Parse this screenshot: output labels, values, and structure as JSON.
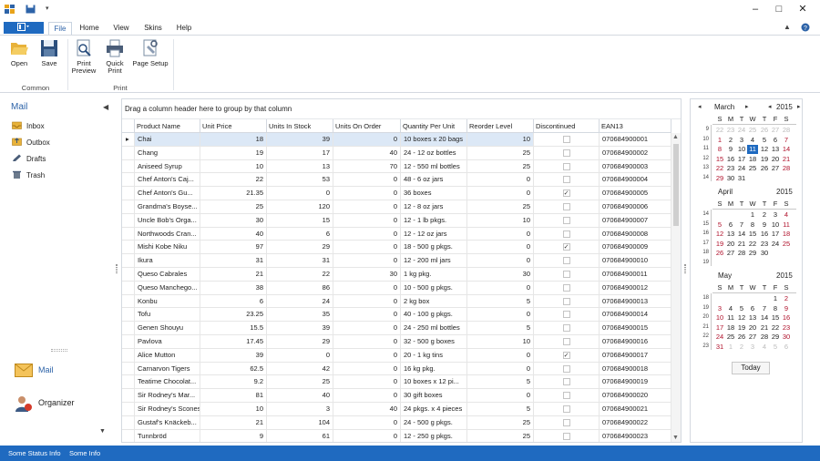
{
  "app": {
    "colors": {
      "accent": "#1f6ac0",
      "weekend": "#b0112b",
      "status_bar": "#1f6ac0"
    }
  },
  "window_controls": {
    "minimize": "‒",
    "maximize": "□",
    "close": "✕"
  },
  "ribbon": {
    "tabs": [
      "File",
      "Home",
      "View",
      "Skins",
      "Help"
    ],
    "active_tab": "File",
    "groups": [
      {
        "label": "Common",
        "buttons": [
          {
            "label": "Open",
            "icon": "folder-open-icon"
          },
          {
            "label": "Save",
            "icon": "floppy-disk-icon"
          }
        ]
      },
      {
        "label": "Print",
        "buttons": [
          {
            "label": "Print Preview",
            "icon": "print-preview-icon"
          },
          {
            "label": "Quick Print",
            "icon": "printer-icon"
          },
          {
            "label": "Page Setup",
            "icon": "page-setup-icon"
          }
        ]
      }
    ]
  },
  "nav": {
    "title": "Mail",
    "items": [
      {
        "label": "Inbox",
        "icon": "inbox-icon"
      },
      {
        "label": "Outbox",
        "icon": "outbox-icon"
      },
      {
        "label": "Drafts",
        "icon": "drafts-icon"
      },
      {
        "label": "Trash",
        "icon": "trash-icon"
      }
    ],
    "modules": [
      {
        "label": "Mail",
        "icon": "mail-envelope-icon",
        "selected": true
      },
      {
        "label": "Organizer",
        "icon": "organizer-people-icon",
        "selected": false
      }
    ]
  },
  "grid": {
    "group_panel_text": "Drag a column header here to group by that column",
    "columns": [
      "Product Name",
      "Unit Price",
      "Units In Stock",
      "Units On Order",
      "Quantity Per Unit",
      "Reorder Level",
      "Discontinued",
      "EAN13"
    ],
    "rows": [
      [
        "Chai",
        "18",
        "39",
        "0",
        "10 boxes x 20 bags",
        "10",
        false,
        "070684900001"
      ],
      [
        "Chang",
        "19",
        "17",
        "40",
        "24 - 12 oz bottles",
        "25",
        false,
        "070684900002"
      ],
      [
        "Aniseed Syrup",
        "10",
        "13",
        "70",
        "12 - 550 ml bottles",
        "25",
        false,
        "070684900003"
      ],
      [
        "Chef Anton's Caj...",
        "22",
        "53",
        "0",
        "48 - 6 oz jars",
        "0",
        false,
        "070684900004"
      ],
      [
        "Chef Anton's Gu...",
        "21.35",
        "0",
        "0",
        "36 boxes",
        "0",
        true,
        "070684900005"
      ],
      [
        "Grandma's Boyse...",
        "25",
        "120",
        "0",
        "12 - 8 oz jars",
        "25",
        false,
        "070684900006"
      ],
      [
        "Uncle Bob's Orga...",
        "30",
        "15",
        "0",
        "12 - 1 lb pkgs.",
        "10",
        false,
        "070684900007"
      ],
      [
        "Northwoods Cran...",
        "40",
        "6",
        "0",
        "12 - 12 oz jars",
        "0",
        false,
        "070684900008"
      ],
      [
        "Mishi Kobe Niku",
        "97",
        "29",
        "0",
        "18 - 500 g pkgs.",
        "0",
        true,
        "070684900009"
      ],
      [
        "Ikura",
        "31",
        "31",
        "0",
        "12 - 200 ml jars",
        "0",
        false,
        "070684900010"
      ],
      [
        "Queso Cabrales",
        "21",
        "22",
        "30",
        "1 kg pkg.",
        "30",
        false,
        "070684900011"
      ],
      [
        "Queso Manchego...",
        "38",
        "86",
        "0",
        "10 - 500 g pkgs.",
        "0",
        false,
        "070684900012"
      ],
      [
        "Konbu",
        "6",
        "24",
        "0",
        "2 kg box",
        "5",
        false,
        "070684900013"
      ],
      [
        "Tofu",
        "23.25",
        "35",
        "0",
        "40 - 100 g pkgs.",
        "0",
        false,
        "070684900014"
      ],
      [
        "Genen Shouyu",
        "15.5",
        "39",
        "0",
        "24 - 250 ml bottles",
        "5",
        false,
        "070684900015"
      ],
      [
        "Pavlova",
        "17.45",
        "29",
        "0",
        "32 - 500 g boxes",
        "10",
        false,
        "070684900016"
      ],
      [
        "Alice Mutton",
        "39",
        "0",
        "0",
        "20 - 1 kg tins",
        "0",
        true,
        "070684900017"
      ],
      [
        "Carnarvon Tigers",
        "62.5",
        "42",
        "0",
        "16 kg pkg.",
        "0",
        false,
        "070684900018"
      ],
      [
        "Teatime Chocolat...",
        "9.2",
        "25",
        "0",
        "10 boxes x 12 pi...",
        "5",
        false,
        "070684900019"
      ],
      [
        "Sir Rodney's Mar...",
        "81",
        "40",
        "0",
        "30 gift boxes",
        "0",
        false,
        "070684900020"
      ],
      [
        "Sir Rodney's Scones",
        "10",
        "3",
        "40",
        "24 pkgs. x 4 pieces",
        "5",
        false,
        "070684900021"
      ],
      [
        "Gustaf's Knäckeb...",
        "21",
        "104",
        "0",
        "24 - 500 g pkgs.",
        "25",
        false,
        "070684900022"
      ],
      [
        "Tunnbröd",
        "9",
        "61",
        "0",
        "12 - 250 g pkgs.",
        "25",
        false,
        "070684900023"
      ]
    ]
  },
  "calendar": {
    "year_label": "2015",
    "weekday_labels": [
      "S",
      "M",
      "T",
      "W",
      "T",
      "F",
      "S"
    ],
    "today_label": "Today",
    "months": [
      {
        "name": "March",
        "show_year": true,
        "weeks": [
          {
            "wk": "9",
            "days": [
              [
                "22",
                "m"
              ],
              [
                "23",
                "m"
              ],
              [
                "24",
                "m"
              ],
              [
                "25",
                "m"
              ],
              [
                "26",
                "m"
              ],
              [
                "27",
                "m"
              ],
              [
                "28",
                "m"
              ]
            ]
          },
          {
            "wk": "10",
            "days": [
              [
                "1",
                "w"
              ],
              [
                "2",
                ""
              ],
              [
                "3",
                ""
              ],
              [
                "4",
                ""
              ],
              [
                "5",
                ""
              ],
              [
                "6",
                ""
              ],
              [
                "7",
                "w"
              ]
            ]
          },
          {
            "wk": "11",
            "days": [
              [
                "8",
                "w"
              ],
              [
                "9",
                ""
              ],
              [
                "10",
                ""
              ],
              [
                "11",
                "t"
              ],
              [
                "12",
                ""
              ],
              [
                "13",
                ""
              ],
              [
                "14",
                "w"
              ]
            ]
          },
          {
            "wk": "12",
            "days": [
              [
                "15",
                "w"
              ],
              [
                "16",
                ""
              ],
              [
                "17",
                ""
              ],
              [
                "18",
                ""
              ],
              [
                "19",
                ""
              ],
              [
                "20",
                ""
              ],
              [
                "21",
                "w"
              ]
            ]
          },
          {
            "wk": "13",
            "days": [
              [
                "22",
                "w"
              ],
              [
                "23",
                ""
              ],
              [
                "24",
                ""
              ],
              [
                "25",
                ""
              ],
              [
                "26",
                ""
              ],
              [
                "27",
                ""
              ],
              [
                "28",
                "w"
              ]
            ]
          },
          {
            "wk": "14",
            "days": [
              [
                "29",
                "w"
              ],
              [
                "30",
                ""
              ],
              [
                "31",
                ""
              ],
              [
                "",
                ""
              ],
              [
                "",
                ""
              ],
              [
                "",
                ""
              ],
              [
                "",
                ""
              ]
            ]
          }
        ]
      },
      {
        "name": "April",
        "show_year": true,
        "weeks": [
          {
            "wk": "14",
            "days": [
              [
                "",
                ""
              ],
              [
                "",
                ""
              ],
              [
                "",
                ""
              ],
              [
                "1",
                ""
              ],
              [
                "2",
                ""
              ],
              [
                "3",
                ""
              ],
              [
                "4",
                "w"
              ]
            ]
          },
          {
            "wk": "15",
            "days": [
              [
                "5",
                "w"
              ],
              [
                "6",
                ""
              ],
              [
                "7",
                ""
              ],
              [
                "8",
                ""
              ],
              [
                "9",
                ""
              ],
              [
                "10",
                ""
              ],
              [
                "11",
                "w"
              ]
            ]
          },
          {
            "wk": "16",
            "days": [
              [
                "12",
                "w"
              ],
              [
                "13",
                ""
              ],
              [
                "14",
                ""
              ],
              [
                "15",
                ""
              ],
              [
                "16",
                ""
              ],
              [
                "17",
                ""
              ],
              [
                "18",
                "w"
              ]
            ]
          },
          {
            "wk": "17",
            "days": [
              [
                "19",
                "w"
              ],
              [
                "20",
                ""
              ],
              [
                "21",
                ""
              ],
              [
                "22",
                ""
              ],
              [
                "23",
                ""
              ],
              [
                "24",
                ""
              ],
              [
                "25",
                "w"
              ]
            ]
          },
          {
            "wk": "18",
            "days": [
              [
                "26",
                "w"
              ],
              [
                "27",
                ""
              ],
              [
                "28",
                ""
              ],
              [
                "29",
                ""
              ],
              [
                "30",
                ""
              ],
              [
                "",
                ""
              ],
              [
                "",
                ""
              ]
            ]
          },
          {
            "wk": "19",
            "days": [
              [
                "",
                ""
              ],
              [
                "",
                ""
              ],
              [
                "",
                ""
              ],
              [
                "",
                ""
              ],
              [
                "",
                ""
              ],
              [
                "",
                ""
              ],
              [
                "",
                ""
              ]
            ]
          }
        ]
      },
      {
        "name": "May",
        "show_year": true,
        "weeks": [
          {
            "wk": "18",
            "days": [
              [
                "",
                ""
              ],
              [
                "",
                ""
              ],
              [
                "",
                ""
              ],
              [
                "",
                ""
              ],
              [
                "",
                ""
              ],
              [
                "1",
                ""
              ],
              [
                "2",
                "w"
              ]
            ]
          },
          {
            "wk": "19",
            "days": [
              [
                "3",
                "w"
              ],
              [
                "4",
                ""
              ],
              [
                "5",
                ""
              ],
              [
                "6",
                ""
              ],
              [
                "7",
                ""
              ],
              [
                "8",
                ""
              ],
              [
                "9",
                "w"
              ]
            ]
          },
          {
            "wk": "20",
            "days": [
              [
                "10",
                "w"
              ],
              [
                "11",
                ""
              ],
              [
                "12",
                ""
              ],
              [
                "13",
                ""
              ],
              [
                "14",
                ""
              ],
              [
                "15",
                ""
              ],
              [
                "16",
                "w"
              ]
            ]
          },
          {
            "wk": "21",
            "days": [
              [
                "17",
                "w"
              ],
              [
                "18",
                ""
              ],
              [
                "19",
                ""
              ],
              [
                "20",
                ""
              ],
              [
                "21",
                ""
              ],
              [
                "22",
                ""
              ],
              [
                "23",
                "w"
              ]
            ]
          },
          {
            "wk": "22",
            "days": [
              [
                "24",
                "w"
              ],
              [
                "25",
                ""
              ],
              [
                "26",
                ""
              ],
              [
                "27",
                ""
              ],
              [
                "28",
                ""
              ],
              [
                "29",
                ""
              ],
              [
                "30",
                "w"
              ]
            ]
          },
          {
            "wk": "23",
            "days": [
              [
                "31",
                "w"
              ],
              [
                "1",
                "m"
              ],
              [
                "2",
                "m"
              ],
              [
                "3",
                "m"
              ],
              [
                "4",
                "m"
              ],
              [
                "5",
                "m"
              ],
              [
                "6",
                "m"
              ]
            ]
          }
        ]
      }
    ]
  },
  "status": {
    "items": [
      "Some Status Info",
      "Some Info"
    ]
  }
}
